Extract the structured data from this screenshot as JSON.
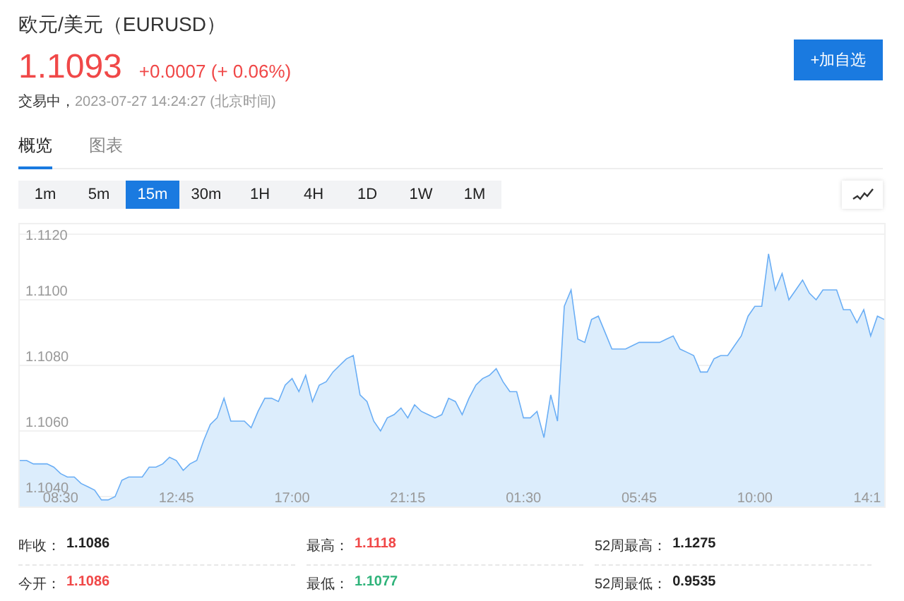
{
  "header": {
    "title": "欧元/美元（EURUSD）",
    "price": "1.1093",
    "change": "+0.0007 (+ 0.06%)",
    "color": "#f04848",
    "status": "交易中，",
    "timestamp": "2023-07-27 14:24:27 (北京时间)",
    "watchlist_button": "+加自选"
  },
  "tabs": [
    {
      "label": "概览",
      "selected": true
    },
    {
      "label": "图表",
      "selected": false
    }
  ],
  "intervals": [
    {
      "label": "1m",
      "selected": false
    },
    {
      "label": "5m",
      "selected": false
    },
    {
      "label": "15m",
      "selected": true
    },
    {
      "label": "30m",
      "selected": false
    },
    {
      "label": "1H",
      "selected": false
    },
    {
      "label": "4H",
      "selected": false
    },
    {
      "label": "1D",
      "selected": false
    },
    {
      "label": "1W",
      "selected": false
    },
    {
      "label": "1M",
      "selected": false
    }
  ],
  "chart": {
    "chart_data": {
      "type": "area",
      "categories": [
        null,
        null,
        null,
        null,
        null,
        null,
        "08:30",
        null,
        null,
        null,
        null,
        null,
        null,
        null,
        null,
        null,
        null,
        null,
        null,
        null,
        null,
        null,
        null,
        "12:45",
        null,
        null,
        null,
        null,
        null,
        null,
        null,
        null,
        null,
        null,
        null,
        null,
        null,
        null,
        null,
        null,
        "17:00",
        null,
        null,
        null,
        null,
        null,
        null,
        null,
        null,
        null,
        null,
        null,
        null,
        null,
        null,
        null,
        null,
        "21:15",
        null,
        null,
        null,
        null,
        null,
        null,
        null,
        null,
        null,
        null,
        null,
        null,
        null,
        null,
        null,
        null,
        "01:30",
        null,
        null,
        null,
        null,
        null,
        null,
        null,
        null,
        null,
        null,
        null,
        null,
        null,
        null,
        null,
        null,
        "05:45",
        null,
        null,
        null,
        null,
        null,
        null,
        null,
        null,
        null,
        null,
        null,
        null,
        null,
        null,
        null,
        null,
        "10:00",
        null,
        null,
        null,
        null,
        null,
        null,
        null,
        null,
        null,
        null,
        null,
        null,
        null,
        null,
        null,
        null,
        "14:1",
        null,
        null
      ],
      "values": [
        1.1051,
        1.1051,
        1.105,
        1.105,
        1.105,
        1.1049,
        1.1047,
        1.1046,
        1.1046,
        1.1044,
        1.1043,
        1.1042,
        1.1039,
        1.1039,
        1.104,
        1.1045,
        1.1046,
        1.1046,
        1.1046,
        1.1049,
        1.1049,
        1.105,
        1.1052,
        1.1051,
        1.1048,
        1.105,
        1.1051,
        1.1057,
        1.1062,
        1.1064,
        1.107,
        1.1063,
        1.1063,
        1.1063,
        1.1061,
        1.1066,
        1.107,
        1.107,
        1.1069,
        1.1074,
        1.1076,
        1.1072,
        1.1077,
        1.1069,
        1.1074,
        1.1075,
        1.1078,
        1.108,
        1.1082,
        1.1083,
        1.1071,
        1.1069,
        1.1063,
        1.106,
        1.1064,
        1.1065,
        1.1067,
        1.1064,
        1.1068,
        1.1066,
        1.1065,
        1.1064,
        1.1065,
        1.107,
        1.1069,
        1.1065,
        1.107,
        1.1074,
        1.1076,
        1.1077,
        1.1079,
        1.1075,
        1.1072,
        1.1072,
        1.1064,
        1.1064,
        1.1066,
        1.1058,
        1.1071,
        1.1063,
        1.1098,
        1.1103,
        1.1088,
        1.1087,
        1.1094,
        1.1095,
        1.109,
        1.1085,
        1.1085,
        1.1085,
        1.1086,
        1.1087,
        1.1087,
        1.1087,
        1.1087,
        1.1088,
        1.1089,
        1.1085,
        1.1084,
        1.1083,
        1.1078,
        1.1078,
        1.1082,
        1.1083,
        1.1083,
        1.1086,
        1.1089,
        1.1095,
        1.1098,
        1.1098,
        1.1114,
        1.1103,
        1.1108,
        1.11,
        1.1103,
        1.1106,
        1.1102,
        1.11,
        1.1103,
        1.1103,
        1.1103,
        1.1097,
        1.1097,
        1.1093,
        1.1097,
        1.1089,
        1.1095,
        1.1094
      ],
      "ylim": [
        1.1037,
        1.1123
      ],
      "grid": true,
      "yticks": [
        {
          "value": 1.104,
          "label": "1.1040"
        },
        {
          "value": 1.106,
          "label": "1.1060"
        },
        {
          "value": 1.108,
          "label": "1.1080"
        },
        {
          "value": 1.11,
          "label": "1.1100"
        },
        {
          "value": 1.112,
          "label": "1.1120"
        }
      ]
    }
  },
  "stats": [
    {
      "label": "昨收：",
      "value": "1.1086",
      "color": "#222222"
    },
    {
      "label": "最高：",
      "value": "1.1118",
      "color": "#f04848"
    },
    {
      "label": "52周最高：",
      "value": "1.1275",
      "color": "#222222"
    },
    {
      "label": "今开：",
      "value": "1.1086",
      "color": "#f04848"
    },
    {
      "label": "最低：",
      "value": "1.1077",
      "color": "#2fb37a"
    },
    {
      "label": "52周最低：",
      "value": "0.9535",
      "color": "#222222"
    }
  ]
}
